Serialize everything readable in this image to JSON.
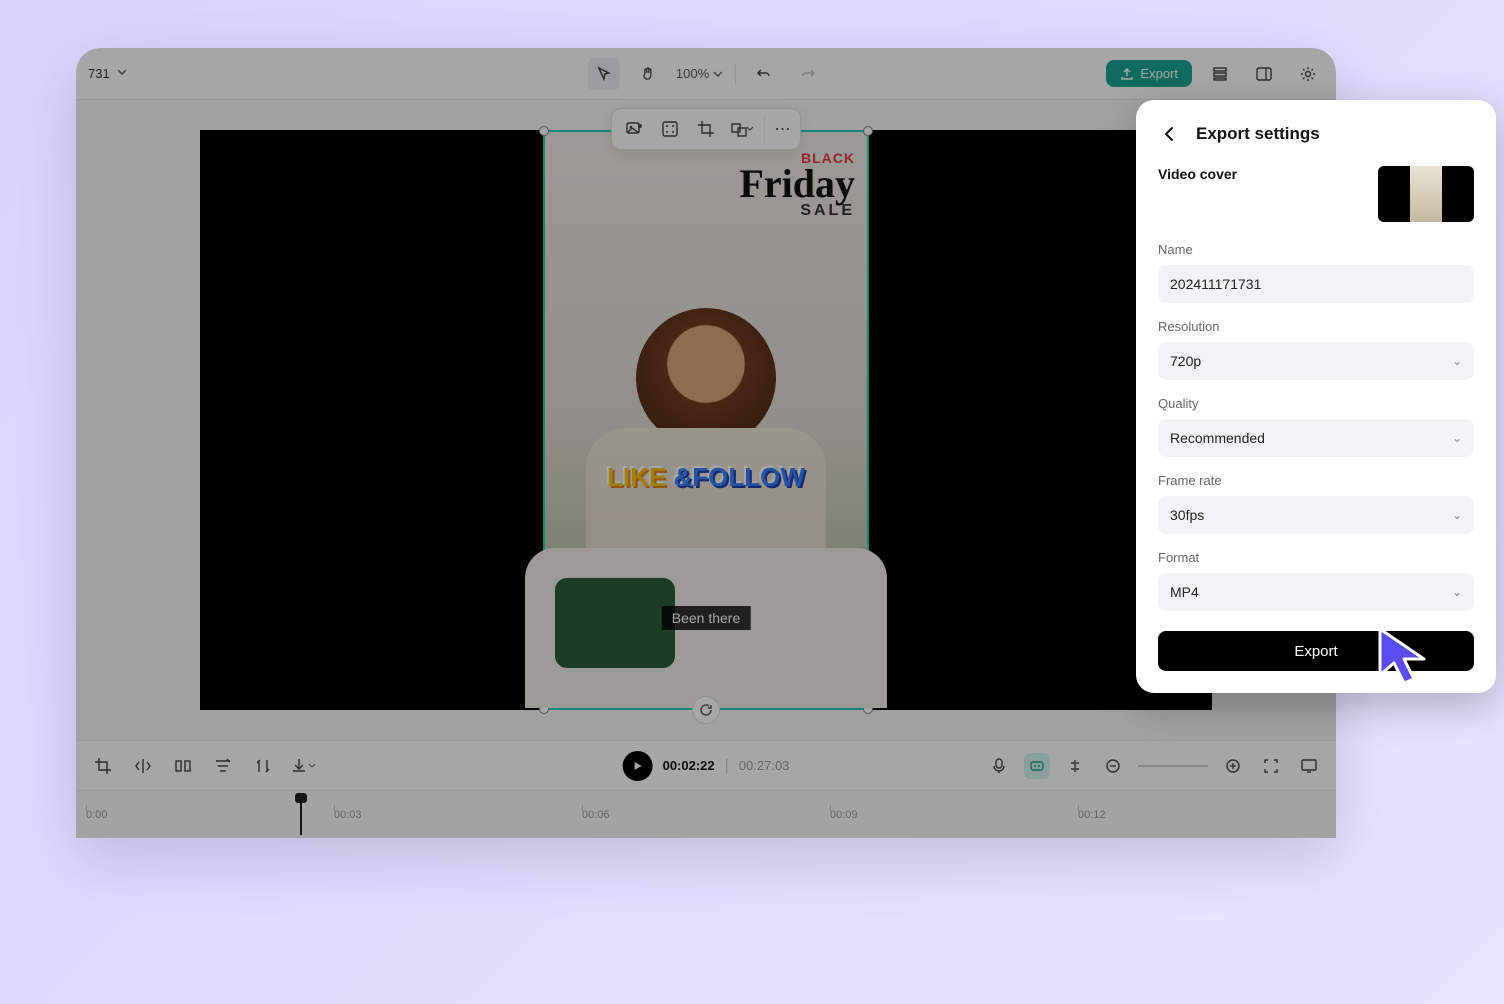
{
  "header": {
    "project_title_fragment": "731",
    "zoom": "100%",
    "export_label": "Export"
  },
  "canvas": {
    "overlay": {
      "black_text": "BLACK",
      "friday_text": "Friday",
      "sale_text": "SALE",
      "like_text": "LIKE",
      "amp_follow_text": " &FOLLOW",
      "caption_text": "Been there"
    }
  },
  "playback": {
    "current_time": "00:02:22",
    "total_time": "00:27:03"
  },
  "timeline": {
    "ticks": [
      "0:00",
      "00:03",
      "00:06",
      "00:09",
      "00:12"
    ]
  },
  "export_panel": {
    "title": "Export settings",
    "video_cover_label": "Video cover",
    "name_label": "Name",
    "name_value": "202411171731",
    "resolution_label": "Resolution",
    "resolution_value": "720p",
    "quality_label": "Quality",
    "quality_value": "Recommended",
    "framerate_label": "Frame rate",
    "framerate_value": "30fps",
    "format_label": "Format",
    "format_value": "MP4",
    "export_button": "Export"
  }
}
